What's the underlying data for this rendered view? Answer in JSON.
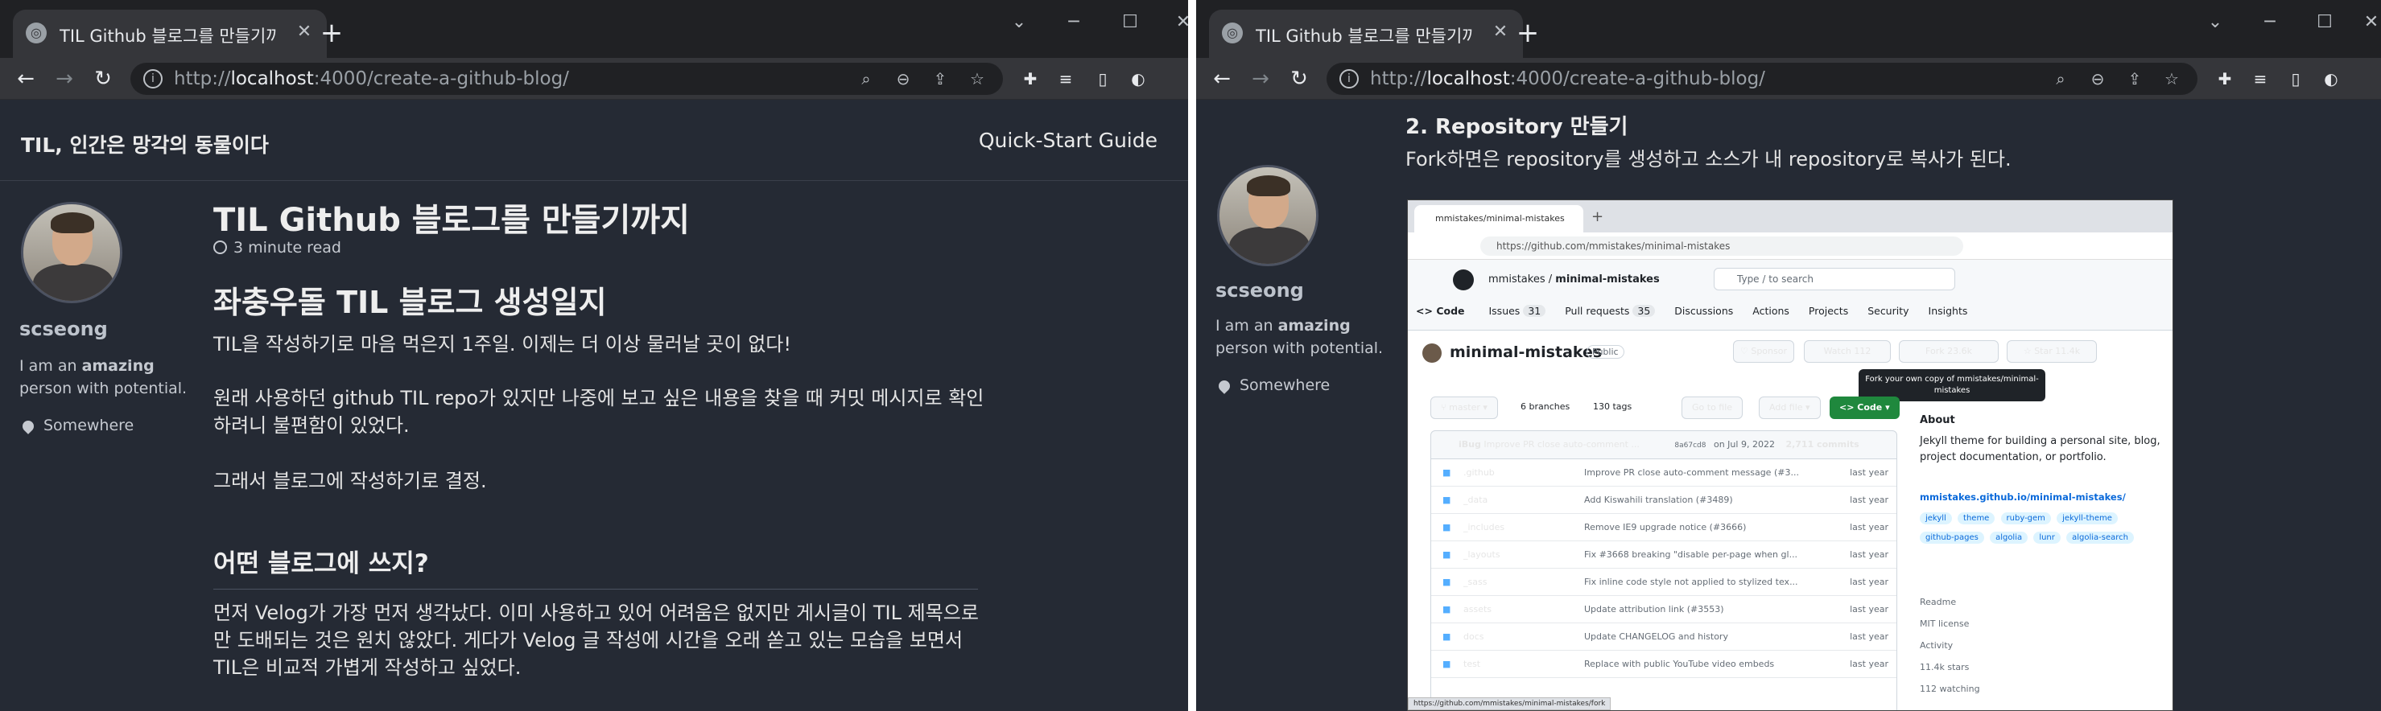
{
  "browser_a": {
    "tab_title": "TIL Github 블로그를 만들기까지",
    "url_host": "localhost",
    "url_rest": ":4000/create-a-github-blog/"
  },
  "browser_b": {
    "tab_title": "TIL Github 블로그를 만들기까지",
    "url_host": "localhost",
    "url_rest": ":4000/create-a-github-blog/"
  },
  "site": {
    "title": "TIL, 인간은 망각의 동물이다",
    "nav_link": "Quick-Start Guide"
  },
  "author": {
    "name": "scseong",
    "bio_prefix": "I am an ",
    "bio_emphasis": "amazing",
    "bio_suffix": " person with potential.",
    "location": "Somewhere"
  },
  "post": {
    "title": "TIL Github 블로그를 만들기까지",
    "read_time": "3 minute read",
    "heading1": "좌충우돌 TIL 블로그 생성일지",
    "para1": "TIL을 작성하기로 마음 먹은지 1주일. 이제는 더 이상 물러날 곳이 없다!",
    "para2": "원래 사용하던 github TIL repo가 있지만 나중에 보고 싶은 내용을 찾을 때 커밋 메시지로 확인하려니 불편함이 있었다.",
    "para3": "그래서 블로그에 작성하기로 결정.",
    "heading2": "어떤 블로그에 쓰지?",
    "para4": "먼저 Velog가 가장 먼저 생각났다. 이미 사용하고 있어 어려움은 없지만 게시글이 TIL 제목으로만 도배되는 것은 원치 않았다. 게다가 Velog 글 작성에 시간을 오래 쏟고 있는 모습을 보면서 TIL은 비교적 가볍게 작성하고 싶었다.",
    "heading3": "2. Repository 만들기",
    "para5": "Fork하면은 repository를 생성하고 소스가 내 repository로 복사가 된다."
  },
  "github": {
    "tab_title": "mmistakes/minimal-mistakes",
    "url": "https://github.com/mmistakes/minimal-mistakes",
    "owner": "mmistakes",
    "repo": "minimal-mistakes",
    "search_placeholder": "Type / to search",
    "tabs": [
      "Code",
      "Issues",
      "Pull requests",
      "Discussions",
      "Actions",
      "Projects",
      "Security",
      "Insights"
    ],
    "issues_count": "31",
    "pr_count": "35",
    "visibility": "Public",
    "sponsor": "Sponsor",
    "watch": "Watch",
    "watch_count": "112",
    "fork": "Fork",
    "fork_count": "23.6k",
    "star": "Star",
    "star_count": "11.4k",
    "tooltip": "Fork your own copy of mmistakes/minimal-mistakes",
    "branch": "master",
    "branches": "6 branches",
    "tags": "130 tags",
    "goto_file": "Go to file",
    "add_file": "Add file",
    "code_btn": "Code",
    "commit_user": "iBug",
    "commit_msg": "Improve PR close auto-comment ...",
    "commit_hash": "8a67cd8",
    "commit_date": "on Jul 9, 2022",
    "commits": "2,711 commits",
    "files": [
      {
        "name": ".github",
        "msg": "Improve PR close auto-comment message (#3...",
        "time": "last year"
      },
      {
        "name": "_data",
        "msg": "Add Kiswahili translation (#3489)",
        "time": "last year"
      },
      {
        "name": "_includes",
        "msg": "Remove IE9 upgrade notice (#3666)",
        "time": "last year"
      },
      {
        "name": "_layouts",
        "msg": "Fix #3668 breaking \"disable per-page when gl...",
        "time": "last year"
      },
      {
        "name": "_sass",
        "msg": "Fix inline code style not applied to stylized tex...",
        "time": "last year"
      },
      {
        "name": "assets",
        "msg": "Update attribution link (#3553)",
        "time": "last year"
      },
      {
        "name": "docs",
        "msg": "Update CHANGELOG and history",
        "time": "last year"
      },
      {
        "name": "test",
        "msg": "Replace with public YouTube video embeds",
        "time": "last year"
      }
    ],
    "about_title": "About",
    "about_desc": "Jekyll theme for building a personal site, blog, project documentation, or portfolio.",
    "about_link": "mmistakes.github.io/minimal-mistakes/",
    "topics": [
      "jekyll",
      "theme",
      "ruby-gem",
      "jekyll-theme",
      "github-pages",
      "algolia",
      "lunr",
      "algolia-search"
    ],
    "side_links": [
      "Readme",
      "MIT license",
      "Activity",
      "11.4k stars",
      "112 watching"
    ],
    "status_url": "https://github.com/mmistakes/minimal-mistakes/fork"
  }
}
